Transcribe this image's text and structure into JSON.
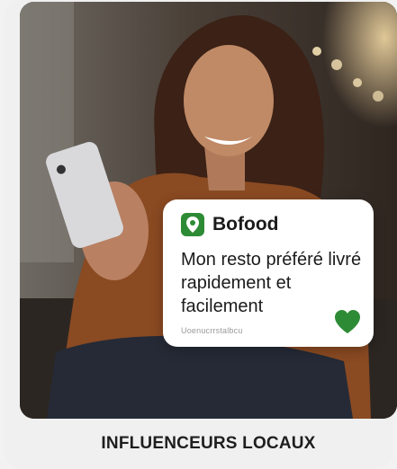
{
  "notification": {
    "brand": "Bofood",
    "brand_icon": "location-pin-icon",
    "message": "Mon resto préféré livré rapidement et facilement",
    "meta": "Uoenucrrstalbcu",
    "action_icon": "heart-icon"
  },
  "caption": "INFLUENCEURS LOCAUX",
  "colors": {
    "accent": "#2e8b35",
    "card_background": "#ffffff",
    "caption_background": "#f0f0f0"
  }
}
